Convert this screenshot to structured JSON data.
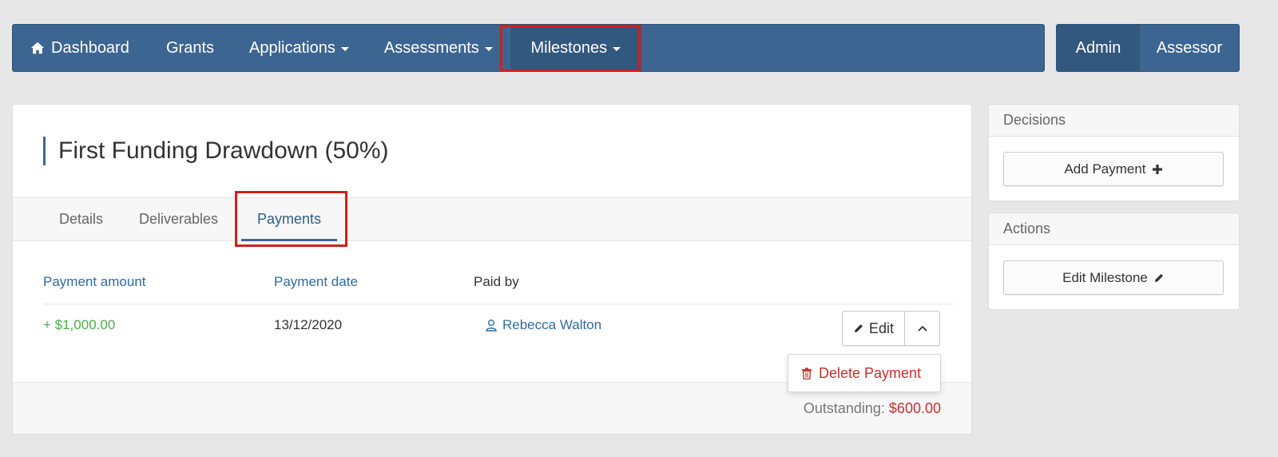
{
  "nav": {
    "items": [
      {
        "label": "Dashboard",
        "icon": "home-icon"
      },
      {
        "label": "Grants"
      },
      {
        "label": "Applications"
      },
      {
        "label": "Assessments"
      },
      {
        "label": "Milestones"
      }
    ],
    "roles": {
      "active": "Admin",
      "other": "Assessor"
    }
  },
  "page": {
    "title": "First Funding Drawdown (50%)",
    "tabs": [
      "Details",
      "Deliverables",
      "Payments"
    ],
    "active_tab": "Payments"
  },
  "payments": {
    "columns": [
      "Payment amount",
      "Payment date",
      "Paid by"
    ],
    "rows": [
      {
        "amount": "+ $1,000.00",
        "date": "13/12/2020",
        "paid_by": "Rebecca Walton"
      }
    ],
    "row_actions": {
      "edit": "Edit",
      "delete": "Delete Payment"
    },
    "outstanding_label": "Outstanding:",
    "outstanding_value": "$600.00"
  },
  "sidebar": {
    "decisions": {
      "title": "Decisions",
      "button": "Add Payment"
    },
    "actions": {
      "title": "Actions",
      "button": "Edit Milestone"
    }
  },
  "colors": {
    "nav_bg": "#3d6591",
    "accent": "#2f6aa0",
    "positive": "#4cae4c",
    "danger": "#c9302c",
    "highlight": "#d0201c"
  }
}
